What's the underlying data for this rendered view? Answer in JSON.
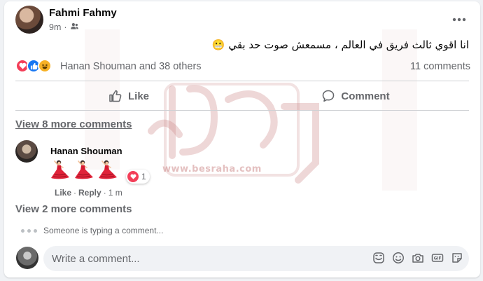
{
  "post": {
    "author": "Fahmi Fahmy",
    "time": "9m",
    "audience_icon": "friends-icon",
    "text": "انا  اقوي ثالث فريق في العالم ، مسمعش صوت حد بقي 😬"
  },
  "reactions": {
    "icons": [
      "love-reaction-icon",
      "like-reaction-icon",
      "haha-reaction-icon"
    ],
    "names": "Hanan Shouman and 38 others",
    "comments_count": "11 comments"
  },
  "actions": {
    "like_label": "Like",
    "comment_label": "Comment"
  },
  "comments": {
    "view_more_top": "View 8 more comments",
    "items": [
      {
        "author": "Hanan Shouman",
        "content": [
          "dancer-emoji",
          "dancer-emoji",
          "dancer-emoji"
        ],
        "reaction_count": "1",
        "like_label": "Like",
        "separator": "·",
        "reply_label": "Reply",
        "time": "1 m"
      }
    ],
    "view_more_bottom": "View 2 more comments",
    "typing_text": "Someone is typing a comment..."
  },
  "composer": {
    "placeholder": "Write a comment...",
    "icons": [
      "sticker-icon",
      "emoji-icon",
      "camera-icon",
      "gif-icon",
      "sticker-face-icon"
    ]
  },
  "watermark": {
    "text": "www.besraha.com"
  },
  "colors": {
    "secondary_text": "#65676b",
    "primary_text": "#050505",
    "love": "#f33e58",
    "like": "#1877f2",
    "haha": "#f7b125",
    "watermark": "#cd8c8c"
  }
}
